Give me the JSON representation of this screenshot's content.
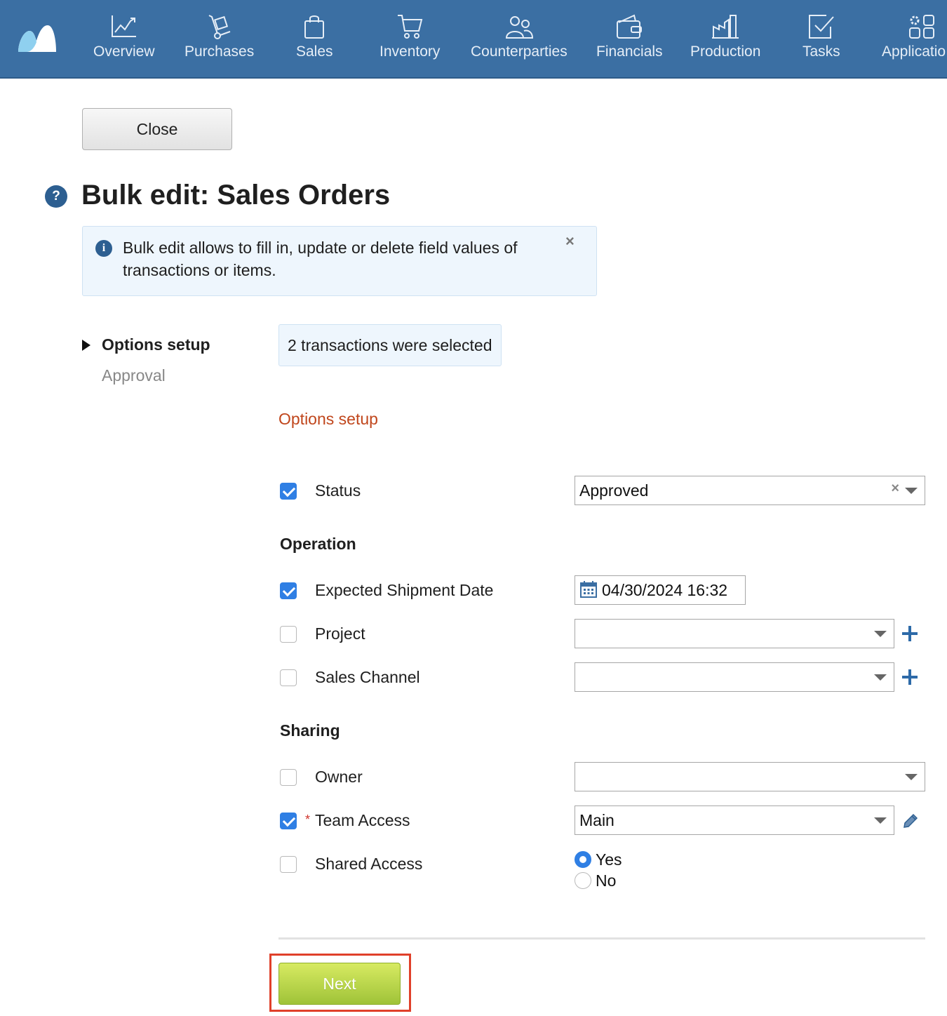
{
  "nav": {
    "items": [
      {
        "label": "Overview",
        "icon": "chart-line-icon"
      },
      {
        "label": "Purchases",
        "icon": "hand-truck-icon"
      },
      {
        "label": "Sales",
        "icon": "shopping-bag-icon"
      },
      {
        "label": "Inventory",
        "icon": "cart-icon"
      },
      {
        "label": "Counterparties",
        "icon": "people-icon"
      },
      {
        "label": "Financials",
        "icon": "wallet-icon"
      },
      {
        "label": "Production",
        "icon": "factory-icon"
      },
      {
        "label": "Tasks",
        "icon": "checkbox-icon"
      },
      {
        "label": "Applicatio",
        "icon": "apps-icon"
      }
    ]
  },
  "toolbar": {
    "close_label": "Close"
  },
  "page": {
    "title": "Bulk edit: Sales Orders"
  },
  "info": {
    "text": "Bulk edit allows to fill in, update or delete field values of transactions or items.",
    "close": "×"
  },
  "sidebar": {
    "active": "Options setup",
    "next": "Approval"
  },
  "selection": {
    "text": "2 transactions were selected"
  },
  "form": {
    "section_title": "Options setup",
    "status": {
      "label": "Status",
      "checked": true,
      "value": "Approved"
    },
    "operation_heading": "Operation",
    "shipment_date": {
      "label": "Expected Shipment Date",
      "checked": true,
      "value": "04/30/2024 16:32"
    },
    "project": {
      "label": "Project",
      "checked": false,
      "value": ""
    },
    "sales_channel": {
      "label": "Sales Channel",
      "checked": false,
      "value": ""
    },
    "sharing_heading": "Sharing",
    "owner": {
      "label": "Owner",
      "checked": false,
      "value": ""
    },
    "team_access": {
      "label": "Team Access",
      "required_mark": "*",
      "checked": true,
      "value": "Main"
    },
    "shared_access": {
      "label": "Shared Access",
      "checked": false,
      "options": [
        "Yes",
        "No"
      ],
      "selected": "Yes"
    }
  },
  "footer": {
    "next_label": "Next"
  },
  "colors": {
    "header": "#3b6fa3",
    "accent": "#2f7fe4",
    "section_title": "#c0461c",
    "next_button": "#a9cc3e",
    "highlight": "#e0402a"
  }
}
